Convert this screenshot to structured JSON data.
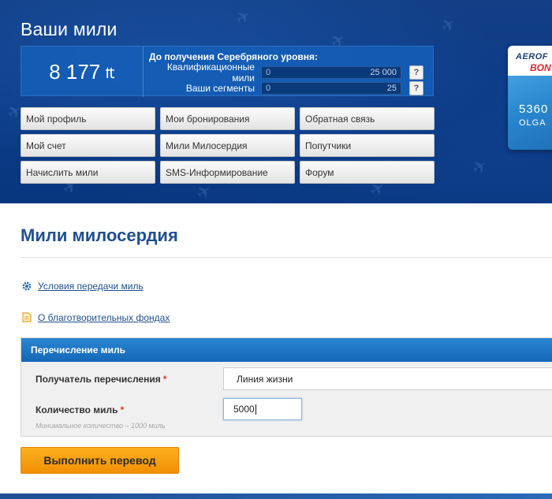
{
  "header": {
    "title": "Ваши мили",
    "balance": "8 177",
    "currency_sign": "₶",
    "goal_title": "До получения Серебряного уровня:",
    "qualifying_miles": {
      "label": "Квалификационные мили",
      "current": "0",
      "target": "25 000"
    },
    "segments": {
      "label": "Ваши сегменты",
      "current": "0",
      "target": "25"
    },
    "help": "?"
  },
  "nav": [
    "Мой профиль",
    "Мои бронирования",
    "Обратная связь",
    "Мой счет",
    "Мили Милосердия",
    "Попутчики",
    "Начислить мили",
    "SMS-Информирование",
    "Форум"
  ],
  "card": {
    "brand_top": "AEROF",
    "brand_bottom": "BON",
    "number": "5360",
    "holder": "OLGA"
  },
  "page": {
    "title": "Мили милосердия",
    "links": {
      "conditions": "Условия передачи миль",
      "funds": "О благотворительных фондах"
    }
  },
  "form": {
    "section_title": "Перечисление миль",
    "recipient_label": "Получатель перечисления",
    "recipient_value": "Линия жизни",
    "amount_label": "Количество миль",
    "amount_value": "5000",
    "required_mark": "*",
    "hint": "Минимальное количество – 1000 миль",
    "submit_label": "Выполнить перевод"
  },
  "colors": {
    "header_bg": "#0d3b86",
    "accent_blue": "#1f4f8f",
    "panel_head": "#1a72c2",
    "submit": "#f7a010",
    "required": "#e4322b"
  }
}
